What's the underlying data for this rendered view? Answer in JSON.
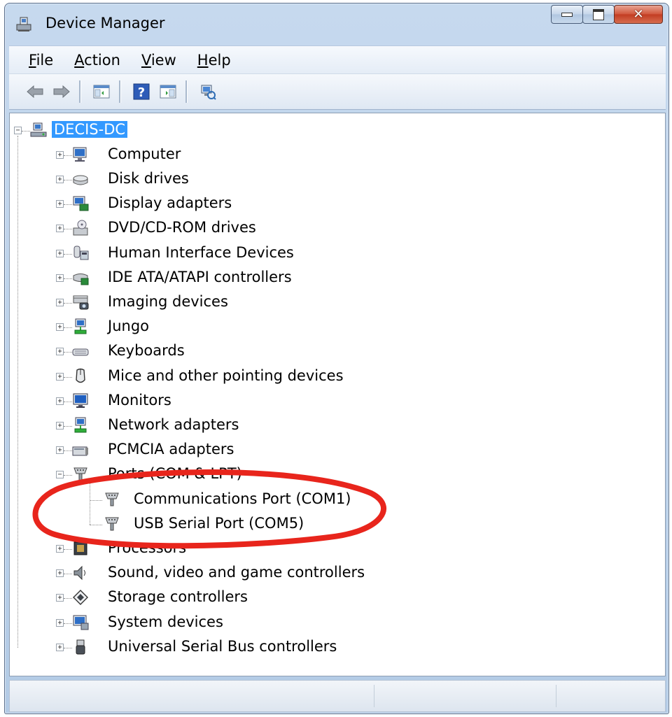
{
  "window": {
    "title": "Device Manager"
  },
  "menu": {
    "items": [
      {
        "mnemonic": "F",
        "rest": "ile"
      },
      {
        "mnemonic": "A",
        "rest": "ction"
      },
      {
        "mnemonic": "V",
        "rest": "iew"
      },
      {
        "mnemonic": "H",
        "rest": "elp"
      }
    ]
  },
  "toolbar": {
    "buttons": [
      "back-icon",
      "forward-icon",
      "show-hide-console-tree-icon",
      "help-icon",
      "action-pane-icon",
      "scan-hardware-icon"
    ]
  },
  "tree": {
    "root": {
      "label": "DECIS-DC",
      "icon": "computer-network-icon",
      "expanded": true,
      "selected": true
    },
    "categories": [
      {
        "label": "Computer",
        "icon": "computer-icon",
        "expanded": false
      },
      {
        "label": "Disk drives",
        "icon": "disk-drive-icon",
        "expanded": false
      },
      {
        "label": "Display adapters",
        "icon": "display-adapter-icon",
        "expanded": false
      },
      {
        "label": "DVD/CD-ROM drives",
        "icon": "dvd-drive-icon",
        "expanded": false
      },
      {
        "label": "Human Interface Devices",
        "icon": "hid-icon",
        "expanded": false
      },
      {
        "label": "IDE ATA/ATAPI controllers",
        "icon": "ide-controller-icon",
        "expanded": false
      },
      {
        "label": "Imaging devices",
        "icon": "imaging-device-icon",
        "expanded": false
      },
      {
        "label": "Jungo",
        "icon": "network-device-icon",
        "expanded": false
      },
      {
        "label": "Keyboards",
        "icon": "keyboard-icon",
        "expanded": false
      },
      {
        "label": "Mice and other pointing devices",
        "icon": "mouse-icon",
        "expanded": false
      },
      {
        "label": "Monitors",
        "icon": "monitor-icon",
        "expanded": false
      },
      {
        "label": "Network adapters",
        "icon": "network-adapter-icon",
        "expanded": false
      },
      {
        "label": "PCMCIA adapters",
        "icon": "pcmcia-icon",
        "expanded": false
      },
      {
        "label": "Ports (COM & LPT)",
        "icon": "port-connector-icon",
        "expanded": true,
        "children": [
          {
            "label": "Communications Port (COM1)",
            "icon": "port-connector-icon"
          },
          {
            "label": "USB Serial Port (COM5)",
            "icon": "port-connector-icon"
          }
        ]
      },
      {
        "label": "Processors",
        "icon": "processor-icon",
        "expanded": false
      },
      {
        "label": "Sound, video and game controllers",
        "icon": "speaker-icon",
        "expanded": false
      },
      {
        "label": "Storage controllers",
        "icon": "storage-controller-icon",
        "expanded": false
      },
      {
        "label": "System devices",
        "icon": "system-device-icon",
        "expanded": false
      },
      {
        "label": "Universal Serial Bus controllers",
        "icon": "usb-icon",
        "expanded": false
      }
    ]
  },
  "colors": {
    "selection": "#3399ff",
    "annotation_circle": "#e8251c"
  }
}
